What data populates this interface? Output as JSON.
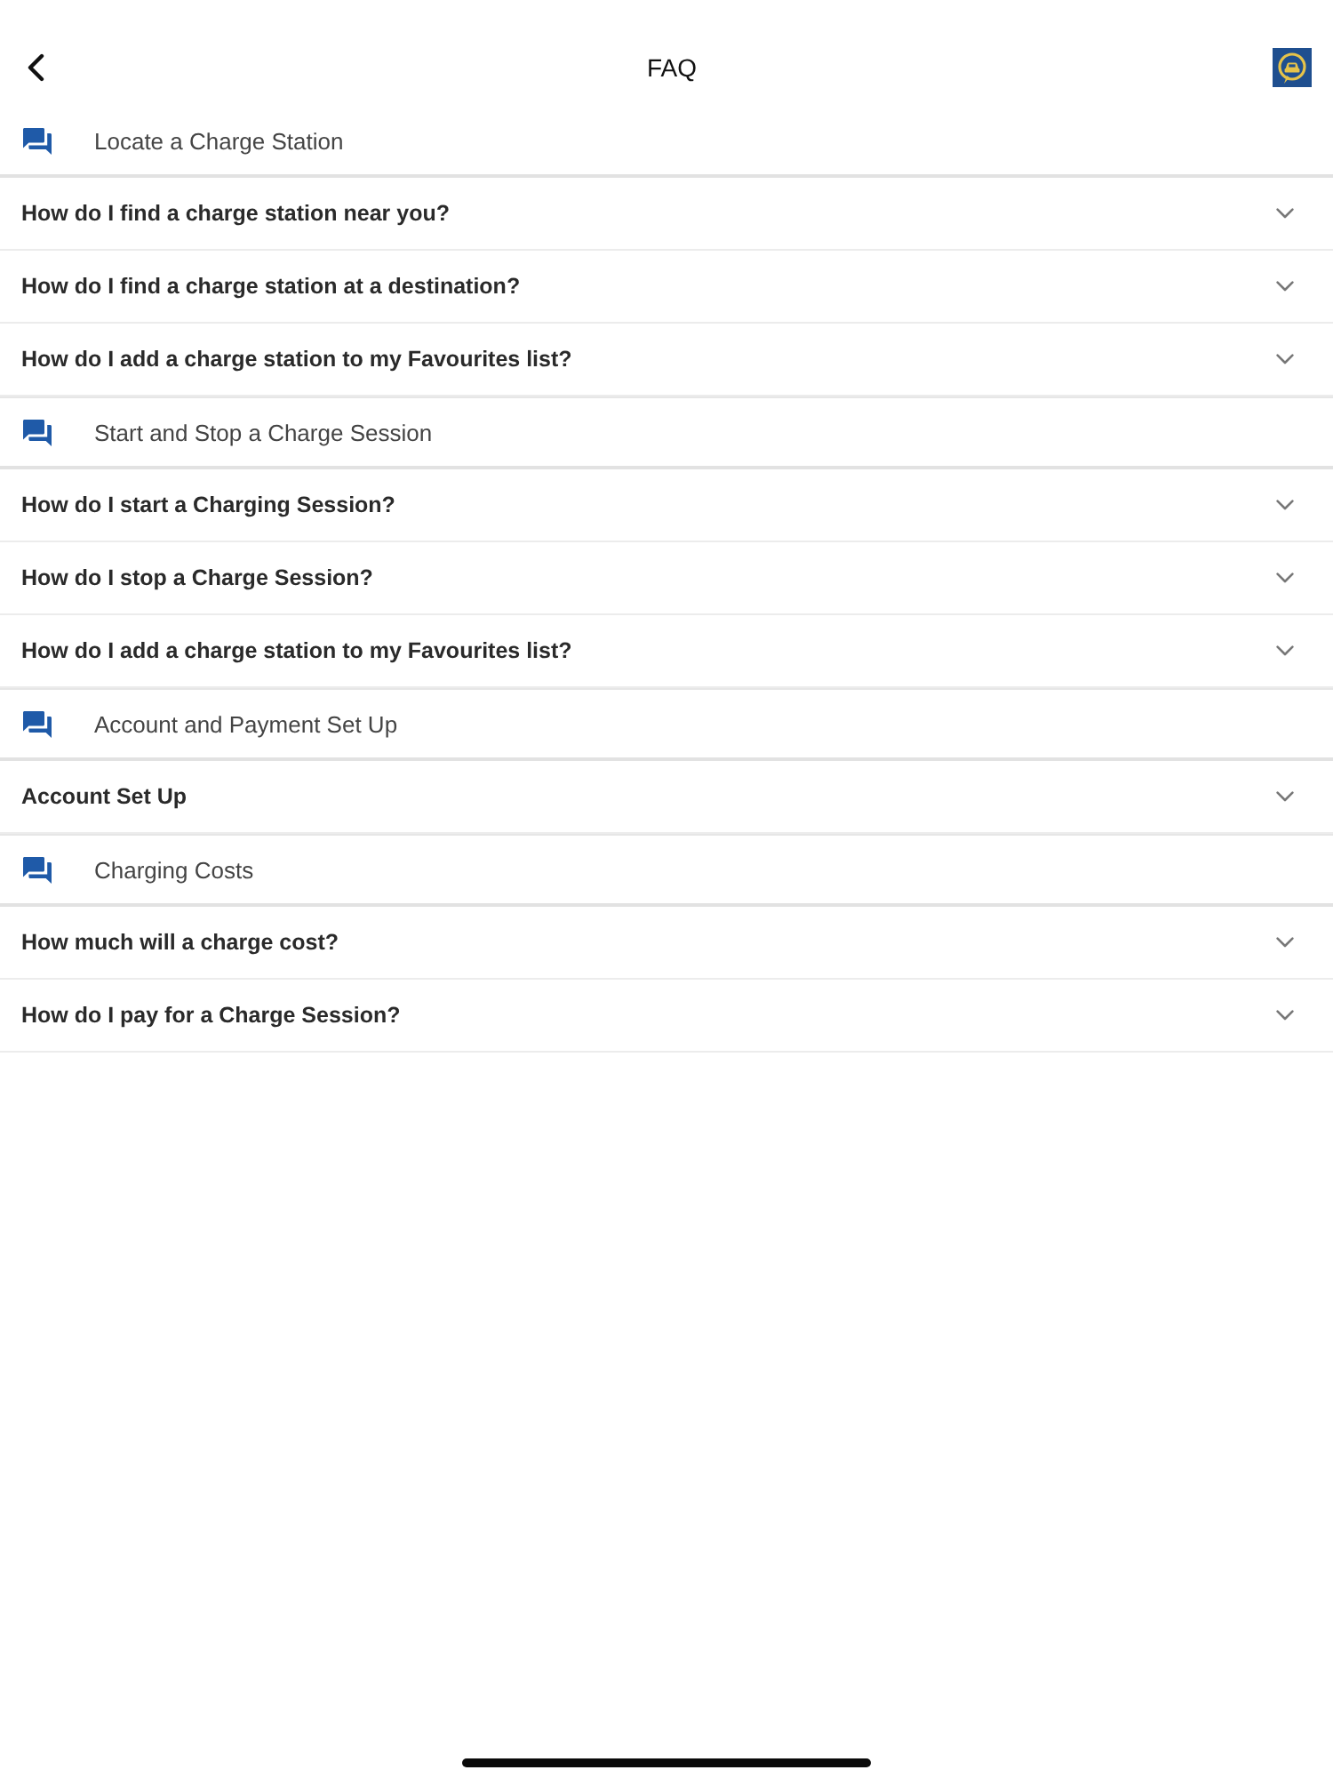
{
  "header": {
    "title": "FAQ"
  },
  "items": [
    {
      "kind": "section",
      "label": "Locate a Charge Station"
    },
    {
      "kind": "question",
      "label": "How do I find a charge station near you?",
      "expanded": false
    },
    {
      "kind": "question",
      "label": "How do I find a charge station at a destination?",
      "expanded": false
    },
    {
      "kind": "question",
      "label": "How do I add a charge station to my Favourites list?",
      "expanded": false
    },
    {
      "kind": "section",
      "label": "Start and Stop a Charge Session"
    },
    {
      "kind": "question",
      "label": "How do I start a Charging Session?",
      "expanded": false
    },
    {
      "kind": "question",
      "label": "How do I stop a Charge Session?",
      "expanded": false
    },
    {
      "kind": "question",
      "label": "How do I add a charge station to my Favourites list?",
      "expanded": false
    },
    {
      "kind": "section",
      "label": "Account and Payment Set Up"
    },
    {
      "kind": "question",
      "label": "Account Set Up",
      "expanded": false
    },
    {
      "kind": "section",
      "label": "Charging Costs"
    },
    {
      "kind": "question",
      "label": "How much will a charge cost?",
      "expanded": false
    },
    {
      "kind": "question",
      "label": "How do I pay for a Charge Session?",
      "expanded": false
    }
  ]
}
